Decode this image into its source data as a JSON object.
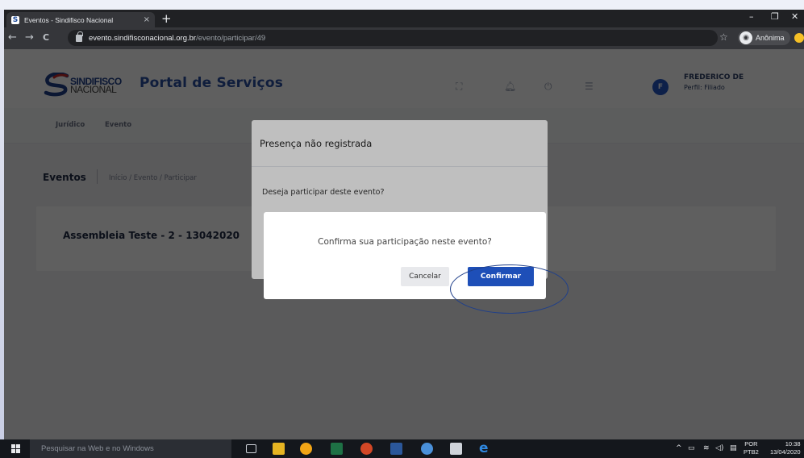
{
  "browser": {
    "tab_title": "Eventos - Sindifisco Nacional",
    "tab_favicon": "S",
    "tab_close": "×",
    "new_tab": "+",
    "url_host": "evento.sindifisconacional.org.br",
    "url_path": "/evento/participar/49",
    "incognito_label": "Anônima",
    "window_controls": {
      "minimize": "–",
      "maximize": "❐",
      "close": "✕"
    },
    "nav": {
      "back": "←",
      "forward": "→",
      "reload": "C"
    },
    "bookmark": "☆"
  },
  "header": {
    "logo_line1": "SINDIFISCO",
    "logo_line2": "NACIONAL",
    "portal_title": "Portal de Serviços",
    "user_initial": "F",
    "user_name": "FREDERICO DE",
    "user_role": "Perfil: Filiado"
  },
  "subnav": {
    "items": [
      "Jurídico",
      "Evento"
    ]
  },
  "breadcrumb": {
    "title": "Eventos",
    "path": "Início  /  Evento  /  Participar"
  },
  "event_card": {
    "title": "Assembleia Teste - 2 - 13042020"
  },
  "modal_back": {
    "title": "Presença não registrada",
    "body": "Deseja participar deste evento?"
  },
  "modal_confirm": {
    "text": "Confirma sua participação neste evento?",
    "cancel_label": "Cancelar",
    "confirm_label": "Confirmar"
  },
  "taskbar": {
    "search_placeholder": "Pesquisar na Web e no Windows",
    "lang_line1": "POR",
    "lang_line2": "PTB2",
    "time": "10:38",
    "date": "13/04/2020",
    "tray_icons": [
      "chevron-up-icon",
      "network-icon",
      "wifi-icon",
      "volume-icon",
      "notification-icon"
    ]
  },
  "colors": {
    "brand_blue": "#1e4fb8",
    "portal_title": "#2a4ea0",
    "annotation_ellipse": "#1f3f8a"
  }
}
